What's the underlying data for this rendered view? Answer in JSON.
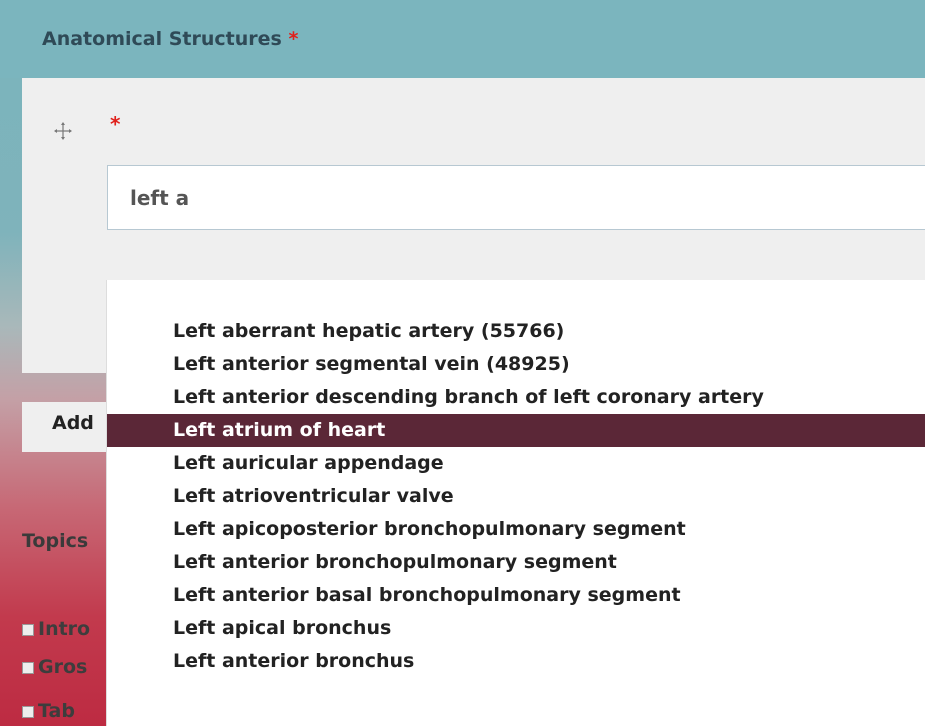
{
  "field": {
    "title": "Anatomical Structures",
    "required_mark": "*",
    "row_required_mark": "*",
    "input_value": "left a"
  },
  "add_button": {
    "label": "Add"
  },
  "topics": {
    "label": "Topics",
    "items": [
      {
        "label": "Intro"
      },
      {
        "label": "Gros"
      },
      {
        "label": "Tab"
      }
    ]
  },
  "suggestions": [
    {
      "label": "Left aberrant hepatic artery (55766)"
    },
    {
      "label": "Left anterior segmental vein (48925)"
    },
    {
      "label": "Left anterior descending branch of left coronary artery"
    },
    {
      "label": "Left atrium of heart",
      "active": true
    },
    {
      "label": "Left auricular appendage"
    },
    {
      "label": "Left atrioventricular valve"
    },
    {
      "label": "Left apicoposterior bronchopulmonary segment"
    },
    {
      "label": "Left anterior bronchopulmonary segment"
    },
    {
      "label": "Left anterior basal bronchopulmonary segment"
    },
    {
      "label": "Left apical bronchus"
    },
    {
      "label": "Left anterior bronchus"
    }
  ],
  "colors": {
    "header_teal": "#7bb5be",
    "active_highlight": "#5b2737",
    "required_red": "#e0201b",
    "bottom_red": "#bd2b42"
  },
  "icons": {
    "drag_handle": "move-arrows-icon"
  }
}
